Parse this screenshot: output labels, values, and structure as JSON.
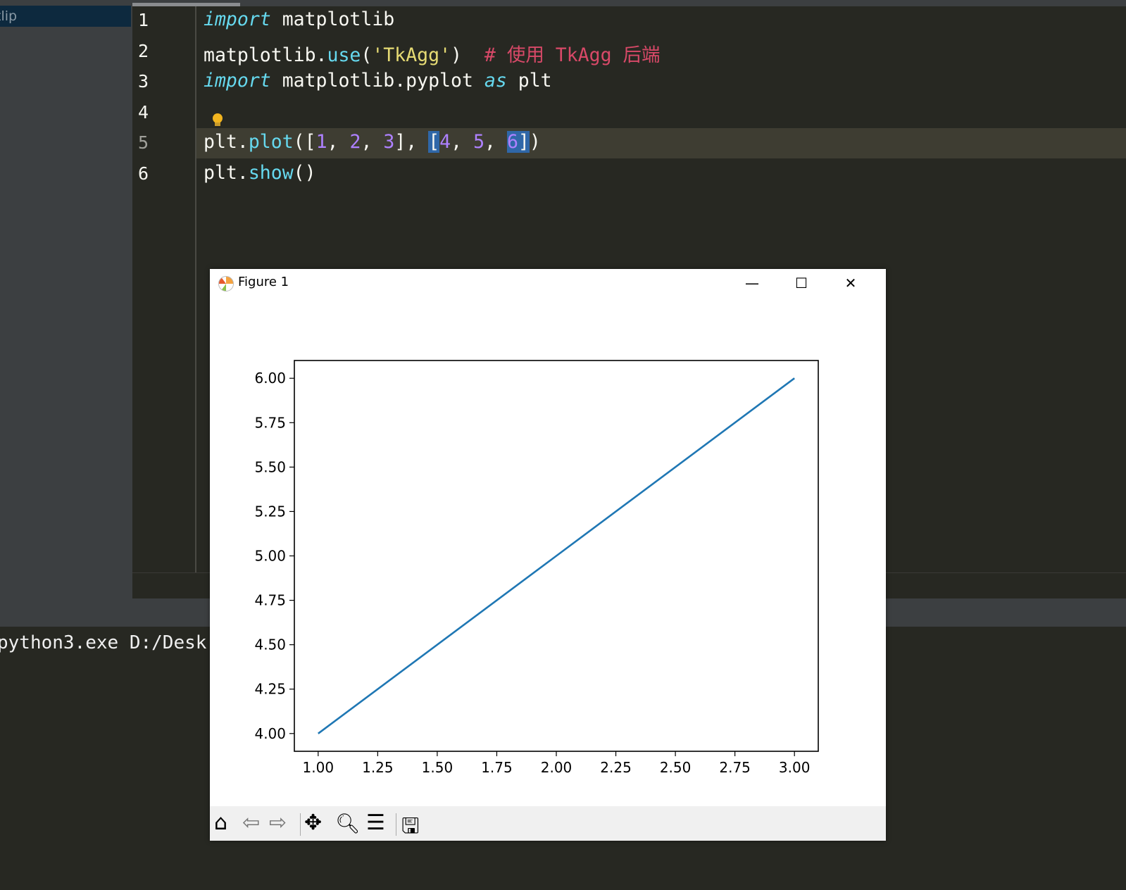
{
  "sidebar": {
    "selected_item": "tlip"
  },
  "editor": {
    "line_numbers": [
      "1",
      "2",
      "3",
      "4",
      "5",
      "6"
    ],
    "current_line": 5
  },
  "console": {
    "text": "python3.exe D:/Desk"
  },
  "figure": {
    "title": "Figure 1",
    "window_buttons": {
      "minimize": "—",
      "maximize": "☐",
      "close": "✕"
    },
    "toolbar": [
      "home-icon",
      "back-icon",
      "forward-icon",
      "pan-icon",
      "zoom-icon",
      "configure-subplots-icon",
      "save-icon"
    ]
  },
  "chart_data": {
    "type": "line",
    "x": [
      1,
      2,
      3
    ],
    "series": [
      {
        "values": [
          4,
          5,
          6
        ],
        "color": "#1f77b4"
      }
    ],
    "xlim": [
      0.9,
      3.1
    ],
    "ylim": [
      3.9,
      6.1
    ],
    "xticks": [
      "1.00",
      "1.25",
      "1.50",
      "1.75",
      "2.00",
      "2.25",
      "2.50",
      "2.75",
      "3.00"
    ],
    "yticks": [
      "4.00",
      "4.25",
      "4.50",
      "4.75",
      "5.00",
      "5.25",
      "5.50",
      "5.75",
      "6.00"
    ],
    "grid": false,
    "title": "",
    "xlabel": "",
    "ylabel": ""
  }
}
